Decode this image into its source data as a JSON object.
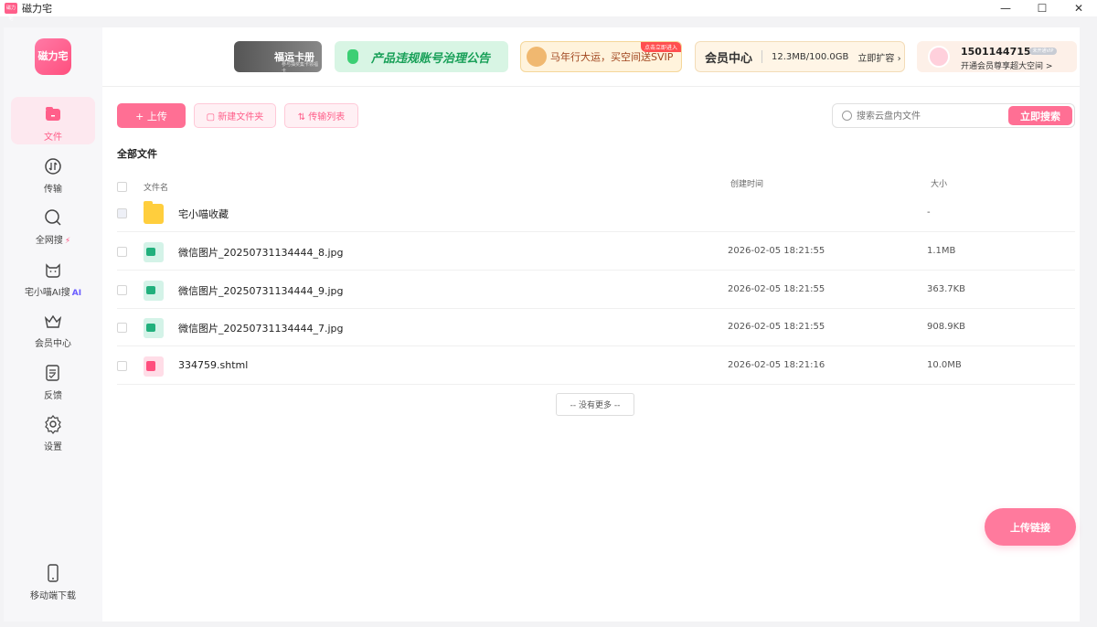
{
  "window": {
    "title": "磁力宅",
    "app_icon_text": "磁力宅",
    "minimize": "—",
    "maximize": "☐",
    "close": "✕"
  },
  "logo_text": "磁力宅",
  "sidebar": {
    "items": [
      {
        "label": "文件",
        "icon": "folder-icon"
      },
      {
        "label": "传输",
        "icon": "transfer-icon"
      },
      {
        "label": "全网搜",
        "icon": "search-icon",
        "badge": "⚡"
      },
      {
        "label": "宅小喵AI搜",
        "icon": "cat-icon",
        "badge": "AI"
      },
      {
        "label": "会员中心",
        "icon": "crown-icon"
      },
      {
        "label": "反馈",
        "icon": "feedback-icon"
      },
      {
        "label": "设置",
        "icon": "gear-icon"
      },
      {
        "label": "移动端下载",
        "icon": "phone-icon"
      }
    ]
  },
  "banners": {
    "fortune": {
      "title": "福运卡册",
      "sub": "参与抽奖集卡领福卡"
    },
    "notice": "产品违规账号治理公告",
    "promo": {
      "text": "马年行大运，买空间送SVIP",
      "tag": "点击立即进入"
    },
    "vip": {
      "title": "会员中心",
      "storage": "12.3MB/100.0GB",
      "expand": "立即扩容 ›"
    },
    "user": {
      "phone": "15011447158",
      "level": "未开通VIP",
      "promo": "开通会员尊享超大空间 >"
    }
  },
  "toolbar": {
    "upload": "+ 上传",
    "new_folder": "▢ 新建文件夹",
    "transfer_list": "⇅ 传输列表"
  },
  "search": {
    "placeholder": "搜索云盘内文件",
    "button": "立即搜索"
  },
  "section_title": "全部文件",
  "columns": {
    "name": "文件名",
    "time": "创建时间",
    "size": "大小"
  },
  "files": [
    {
      "name": "宅小喵收藏",
      "time": "",
      "size": "-",
      "type": "folder"
    },
    {
      "name": "微信图片_20250731134444_8.jpg",
      "time": "2026-02-05 18:21:55",
      "size": "1.1MB",
      "type": "image"
    },
    {
      "name": "微信图片_20250731134444_9.jpg",
      "time": "2026-02-05 18:21:55",
      "size": "363.7KB",
      "type": "image"
    },
    {
      "name": "微信图片_20250731134444_7.jpg",
      "time": "2026-02-05 18:21:55",
      "size": "908.9KB",
      "type": "image"
    },
    {
      "name": "334759.shtml",
      "time": "2026-02-05 18:21:16",
      "size": "10.0MB",
      "type": "html"
    }
  ],
  "no_more": "-- 没有更多 --",
  "float_upload": "上传链接",
  "colors": {
    "accent": "#ff6f94",
    "active_bg": "#fde8ef"
  }
}
